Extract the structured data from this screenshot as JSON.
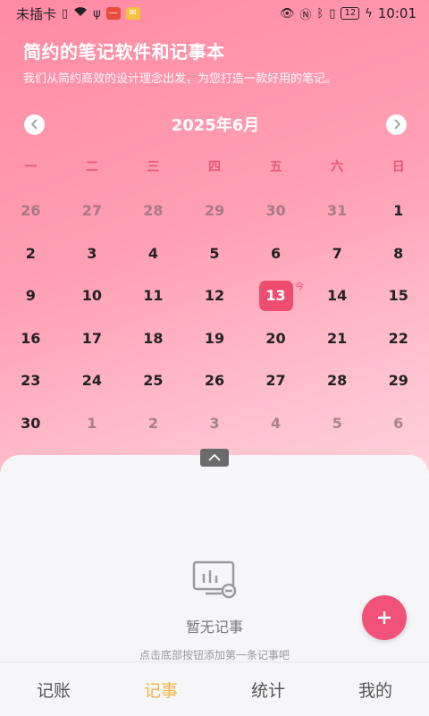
{
  "status_bar": {
    "carrier": "未插卡",
    "battery": "12",
    "time": "10:01"
  },
  "header": {
    "title": "简约的笔记软件和记事本",
    "subtitle": "我们从简约高效的设计理念出发，为您打造一款好用的笔记。"
  },
  "calendar": {
    "month_title": "2025年6月",
    "weekdays": [
      "一",
      "二",
      "三",
      "四",
      "五",
      "六",
      "日"
    ],
    "today_mark": "今",
    "days": [
      {
        "n": "26",
        "m": true
      },
      {
        "n": "27",
        "m": true
      },
      {
        "n": "28",
        "m": true
      },
      {
        "n": "29",
        "m": true
      },
      {
        "n": "30",
        "m": true
      },
      {
        "n": "31",
        "m": true
      },
      {
        "n": "1",
        "m": false
      },
      {
        "n": "2",
        "m": false
      },
      {
        "n": "3",
        "m": false
      },
      {
        "n": "4",
        "m": false
      },
      {
        "n": "5",
        "m": false
      },
      {
        "n": "6",
        "m": false
      },
      {
        "n": "7",
        "m": false
      },
      {
        "n": "8",
        "m": false
      },
      {
        "n": "9",
        "m": false
      },
      {
        "n": "10",
        "m": false
      },
      {
        "n": "11",
        "m": false
      },
      {
        "n": "12",
        "m": false
      },
      {
        "n": "13",
        "m": false,
        "today": true
      },
      {
        "n": "14",
        "m": false
      },
      {
        "n": "15",
        "m": false
      },
      {
        "n": "16",
        "m": false
      },
      {
        "n": "17",
        "m": false
      },
      {
        "n": "18",
        "m": false
      },
      {
        "n": "19",
        "m": false
      },
      {
        "n": "20",
        "m": false
      },
      {
        "n": "21",
        "m": false
      },
      {
        "n": "22",
        "m": false
      },
      {
        "n": "23",
        "m": false
      },
      {
        "n": "24",
        "m": false
      },
      {
        "n": "25",
        "m": false
      },
      {
        "n": "26",
        "m": false
      },
      {
        "n": "27",
        "m": false
      },
      {
        "n": "28",
        "m": false
      },
      {
        "n": "29",
        "m": false
      },
      {
        "n": "30",
        "m": false
      },
      {
        "n": "1",
        "m": true
      },
      {
        "n": "2",
        "m": true
      },
      {
        "n": "3",
        "m": true
      },
      {
        "n": "4",
        "m": true
      },
      {
        "n": "5",
        "m": true
      },
      {
        "n": "6",
        "m": true
      }
    ]
  },
  "empty_state": {
    "title": "暂无记事",
    "hint": "点击底部按钮添加第一条记事吧"
  },
  "fab": {
    "icon": "plus-icon"
  },
  "tabs": [
    {
      "label": "记账",
      "active": false
    },
    {
      "label": "记事",
      "active": true
    },
    {
      "label": "统计",
      "active": false
    },
    {
      "label": "我的",
      "active": false
    }
  ],
  "colors": {
    "accent": "#ef4d6f",
    "tab_active": "#f2b544"
  }
}
